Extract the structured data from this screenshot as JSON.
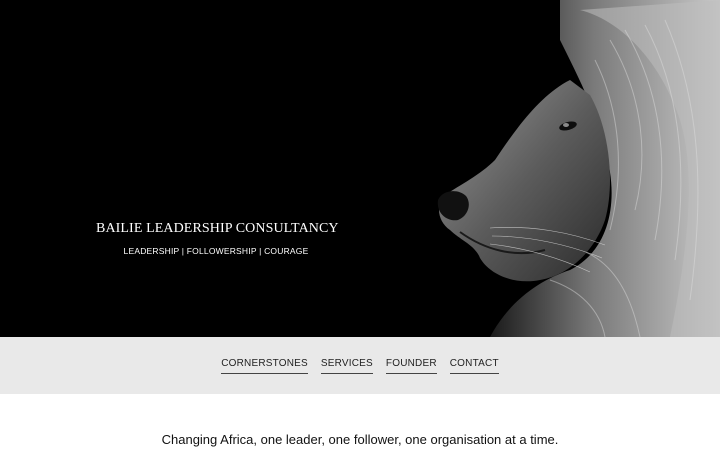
{
  "hero": {
    "title": "BAILIE LEADERSHIP CONSULTANCY",
    "tagline": "LEADERSHIP | FOLLOWERSHIP | COURAGE",
    "image": "lion-profile-image",
    "background_color": "#000000"
  },
  "nav": {
    "background_color": "#e9e9e9",
    "items": [
      {
        "label": "CORNERSTONES"
      },
      {
        "label": "SERVICES"
      },
      {
        "label": "FOUNDER"
      },
      {
        "label": "CONTACT"
      }
    ]
  },
  "main": {
    "mission": "Changing Africa, one leader, one follower, one organisation at a time."
  }
}
